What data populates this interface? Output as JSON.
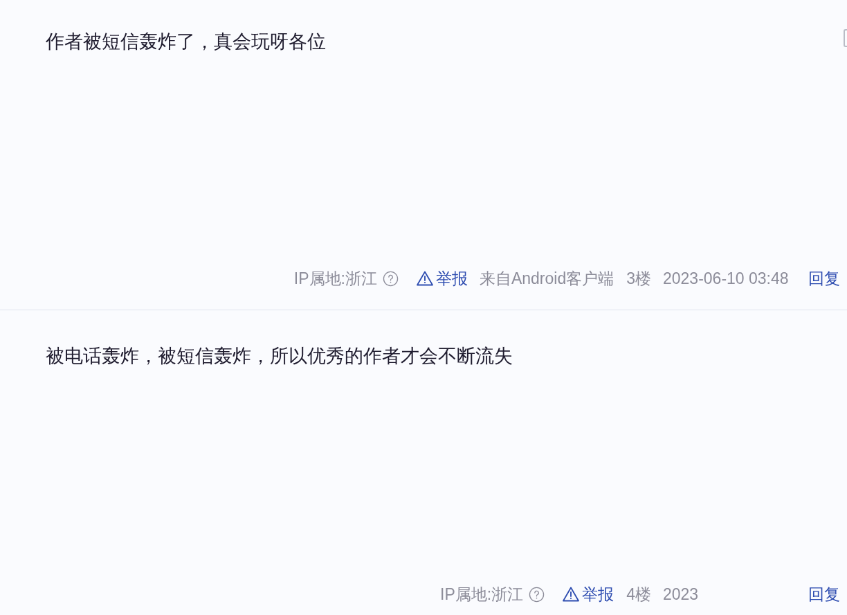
{
  "posts": [
    {
      "content": "作者被短信轰炸了，真会玩呀各位",
      "meta": {
        "ip_location": "IP属地:浙江",
        "report": "举报",
        "source": "来自Android客户端",
        "floor": "3楼",
        "time": "2023-06-10 03:48",
        "reply": "回复"
      }
    },
    {
      "content": "被电话轰炸，被短信轰炸，所以优秀的作者才会不断流失",
      "meta": {
        "ip_location": "IP属地:浙江",
        "report": "举报",
        "floor": "4楼",
        "time": "2023",
        "reply": "回复"
      }
    }
  ]
}
